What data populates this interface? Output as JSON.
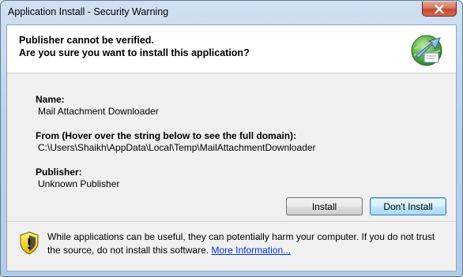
{
  "window": {
    "title": "Application Install - Security Warning"
  },
  "header": {
    "line1": "Publisher cannot be verified.",
    "line2": "Are you sure you want to install this application?"
  },
  "details": {
    "name_label": "Name:",
    "name_value": "Mail Attachment Downloader",
    "from_label": "From (Hover over the string below to see the full domain):",
    "from_value": "C:\\Users\\Shaikh\\AppData\\Local\\Temp\\MailAttachmentDownloader",
    "publisher_label": "Publisher:",
    "publisher_value": "Unknown Publisher"
  },
  "buttons": {
    "install": "Install",
    "dont_install": "Don't Install"
  },
  "footer": {
    "warning_text": "While applications can be useful, they can potentially harm your computer. If you do not trust the source, do not install this software.",
    "link_text": "More Information..."
  },
  "icons": {
    "close": "close-icon",
    "app": "clickonce-install-icon",
    "shield": "warning-shield-icon"
  },
  "colors": {
    "link": "#0033cc",
    "shield_yellow": "#f5d200",
    "close_red": "#c14a33"
  }
}
